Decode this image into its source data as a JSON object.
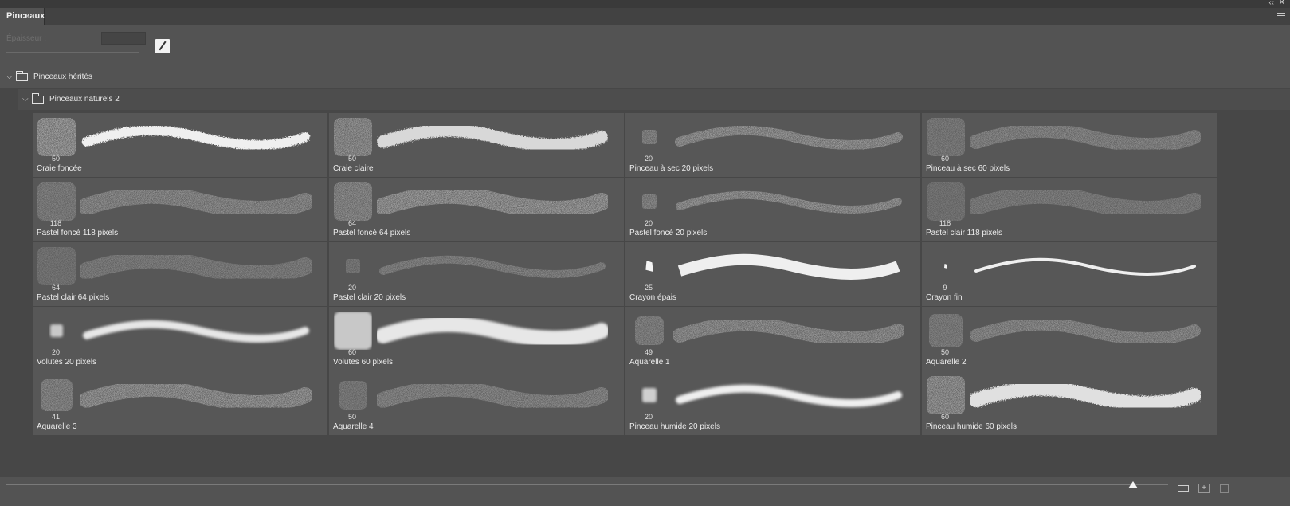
{
  "window": {
    "collapse_glyph": "‹‹",
    "close_glyph": "✕"
  },
  "panel": {
    "tab_label": "Pinceaux",
    "menu_icon": "hamburger-menu-icon"
  },
  "size_control": {
    "label": "Épaisseur :",
    "value": ""
  },
  "folders": [
    {
      "label": "Pinceaux hérités",
      "expanded": true
    },
    {
      "label": "Pinceaux naturels 2",
      "expanded": true
    }
  ],
  "brushes": [
    {
      "name": "Craie foncée",
      "size": "50"
    },
    {
      "name": "Craie claire",
      "size": "50"
    },
    {
      "name": "Pinceau à sec 20 pixels",
      "size": "20"
    },
    {
      "name": "Pinceau à sec 60 pixels",
      "size": "60"
    },
    {
      "name": "Pastel foncé 118 pixels",
      "size": "118"
    },
    {
      "name": "Pastel foncé 64 pixels",
      "size": "64"
    },
    {
      "name": "Pastel foncé 20 pixels",
      "size": "20"
    },
    {
      "name": "Pastel clair 118 pixels",
      "size": "118"
    },
    {
      "name": "Pastel clair 64 pixels",
      "size": "64"
    },
    {
      "name": "Pastel clair 20 pixels",
      "size": "20"
    },
    {
      "name": "Crayon épais",
      "size": "25"
    },
    {
      "name": "Crayon fin",
      "size": "9"
    },
    {
      "name": "Volutes 20 pixels",
      "size": "20"
    },
    {
      "name": "Volutes 60 pixels",
      "size": "60"
    },
    {
      "name": "Aquarelle 1",
      "size": "49"
    },
    {
      "name": "Aquarelle 2",
      "size": "50"
    },
    {
      "name": "Aquarelle 3",
      "size": "41"
    },
    {
      "name": "Aquarelle 4",
      "size": "50"
    },
    {
      "name": "Pinceau humide 20 pixels",
      "size": "20"
    },
    {
      "name": "Pinceau humide 60 pixels",
      "size": "60"
    }
  ],
  "footer": {
    "preview_size_level": 0.97
  }
}
